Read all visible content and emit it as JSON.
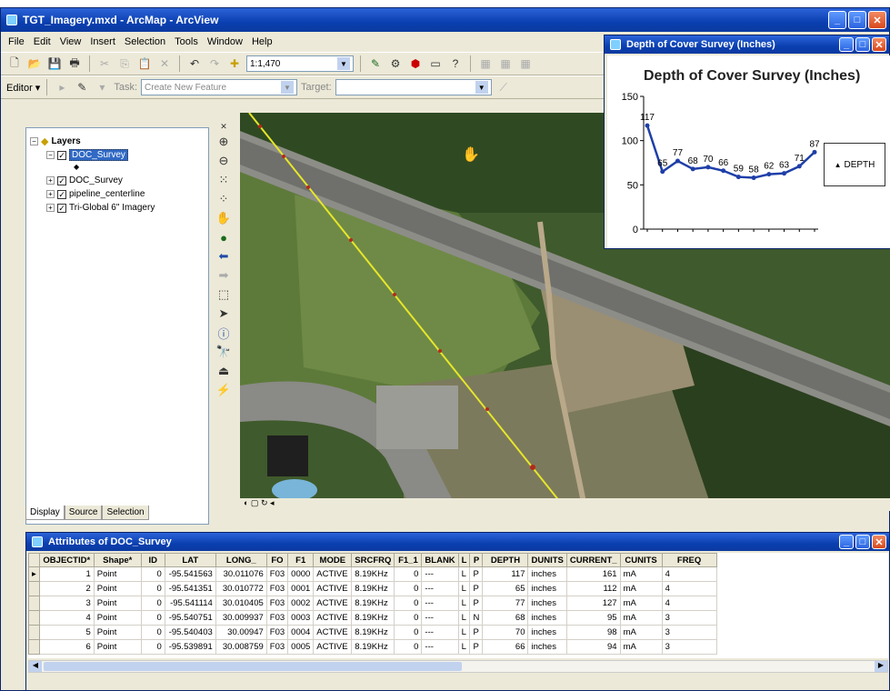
{
  "app": {
    "title": "TGT_Imagery.mxd - ArcMap - ArcView",
    "menu": [
      "File",
      "Edit",
      "View",
      "Insert",
      "Selection",
      "Tools",
      "Window",
      "Help"
    ],
    "scale": "1:1,470",
    "editor_label": "Editor",
    "task_label": "Task:",
    "task_value": "Create New Feature",
    "target_label": "Target:"
  },
  "toc": {
    "root": "Layers",
    "items": [
      "DOC_Survey",
      "DOC_Survey",
      "pipeline_centerline",
      "Tri-Global 6\" Imagery"
    ],
    "tabs": [
      "Display",
      "Source",
      "Selection"
    ]
  },
  "chart_window": {
    "title": "Depth of Cover Survey (Inches)"
  },
  "chart_data": {
    "type": "line",
    "title": "Depth of Cover Survey (Inches)",
    "series": [
      {
        "name": "DEPTH",
        "values": [
          117,
          65,
          77,
          68,
          70,
          66,
          59,
          58,
          62,
          63,
          71,
          87
        ]
      }
    ],
    "ylim": [
      0,
      150
    ],
    "yticks": [
      "150",
      "100",
      "50",
      "0"
    ],
    "legend": "right"
  },
  "attr": {
    "title": "Attributes of DOC_Survey",
    "columns": [
      "OBJECTID*",
      "Shape*",
      "ID",
      "LAT",
      "LONG_",
      "FO",
      "F1",
      "MODE",
      "SRCFRQ",
      "F1_1",
      "BLANK",
      "L",
      "P",
      "DEPTH",
      "DUNITS",
      "CURRENT_",
      "CUNITS",
      "FREQ"
    ],
    "rows": [
      [
        "1",
        "Point",
        "0",
        "-95.541563",
        "30.011076",
        "F03",
        "0000",
        "ACTIVE",
        "8.19KHz",
        "0",
        "---",
        "L",
        "P",
        "117",
        "inches",
        "161",
        "mA",
        "4"
      ],
      [
        "2",
        "Point",
        "0",
        "-95.541351",
        "30.010772",
        "F03",
        "0001",
        "ACTIVE",
        "8.19KHz",
        "0",
        "---",
        "L",
        "P",
        "65",
        "inches",
        "112",
        "mA",
        "4"
      ],
      [
        "3",
        "Point",
        "0",
        "-95.541114",
        "30.010405",
        "F03",
        "0002",
        "ACTIVE",
        "8.19KHz",
        "0",
        "---",
        "L",
        "P",
        "77",
        "inches",
        "127",
        "mA",
        "4"
      ],
      [
        "4",
        "Point",
        "0",
        "-95.540751",
        "30.009937",
        "F03",
        "0003",
        "ACTIVE",
        "8.19KHz",
        "0",
        "---",
        "L",
        "N",
        "68",
        "inches",
        "95",
        "mA",
        "3"
      ],
      [
        "5",
        "Point",
        "0",
        "-95.540403",
        "30.00947",
        "F03",
        "0004",
        "ACTIVE",
        "8.19KHz",
        "0",
        "---",
        "L",
        "P",
        "70",
        "inches",
        "98",
        "mA",
        "3"
      ],
      [
        "6",
        "Point",
        "0",
        "-95.539891",
        "30.008759",
        "F03",
        "0005",
        "ACTIVE",
        "8.19KHz",
        "0",
        "---",
        "L",
        "P",
        "66",
        "inches",
        "94",
        "mA",
        "3"
      ]
    ]
  }
}
